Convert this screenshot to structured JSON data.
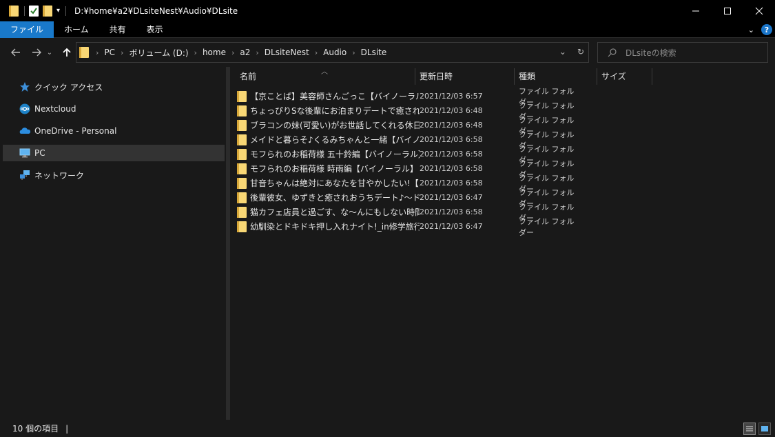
{
  "window": {
    "title": "D:¥home¥a2¥DLsiteNest¥Audio¥DLsite",
    "controls": [
      "minimize",
      "maximize",
      "close"
    ]
  },
  "ribbon": {
    "tabs": [
      {
        "label": "ファイル",
        "active": true
      },
      {
        "label": "ホーム"
      },
      {
        "label": "共有"
      },
      {
        "label": "表示"
      }
    ],
    "help_label": "?"
  },
  "address": {
    "crumbs": [
      "PC",
      "ボリューム (D:)",
      "home",
      "a2",
      "DLsiteNest",
      "Audio",
      "DLsite"
    ]
  },
  "search": {
    "placeholder": "DLsiteの検索"
  },
  "sidebar": {
    "items": [
      {
        "label": "クイック アクセス",
        "icon": "star-icon"
      },
      {
        "label": "Nextcloud",
        "icon": "nextcloud-icon"
      },
      {
        "label": "OneDrive - Personal",
        "icon": "cloud-icon"
      },
      {
        "label": "PC",
        "icon": "pc-icon",
        "selected": true
      },
      {
        "label": "ネットワーク",
        "icon": "network-icon"
      }
    ]
  },
  "columns": {
    "name": "名前",
    "date": "更新日時",
    "type": "種類",
    "size": "サイズ"
  },
  "files": [
    {
      "name": "【京ことば】美容師さんごっこ【バイノーラル】",
      "date": "2021/12/03 6:57",
      "type": "ファイル フォルダー"
    },
    {
      "name": "ちょっぴりSな後輩にお泊まりデートで癒されて【...",
      "date": "2021/12/03 6:48",
      "type": "ファイル フォルダー"
    },
    {
      "name": "ブラコンの妹(可愛い)がお世話してくれる休日【...",
      "date": "2021/12/03 6:48",
      "type": "ファイル フォルダー"
    },
    {
      "name": "メイドと暮らそ♪くるみちゃんと一緒【バイノーラ...",
      "date": "2021/12/03 6:58",
      "type": "ファイル フォルダー"
    },
    {
      "name": "モフられのお稲荷様 五十鈴編【バイノーラル】",
      "date": "2021/12/03 6:58",
      "type": "ファイル フォルダー"
    },
    {
      "name": "モフられのお稲荷様 時雨編【バイノーラル】",
      "date": "2021/12/03 6:58",
      "type": "ファイル フォルダー"
    },
    {
      "name": "甘音ちゃんは絶対にあなたを甘やかしたい!【バ...",
      "date": "2021/12/03 6:58",
      "type": "ファイル フォルダー"
    },
    {
      "name": "後輩彼女、ゆずきと癒されおうちデート♪～ド...",
      "date": "2021/12/03 6:47",
      "type": "ファイル フォルダー"
    },
    {
      "name": "猫カフェ店員と過ごす、な～んにもしない時間【...",
      "date": "2021/12/03 6:58",
      "type": "ファイル フォルダー"
    },
    {
      "name": "幼馴染とドキドキ押し入れナイト!_in修学旅行...",
      "date": "2021/12/03 6:47",
      "type": "ファイル フォルダー"
    }
  ],
  "status": {
    "count_text": "10 個の項目",
    "cursor": "|"
  }
}
